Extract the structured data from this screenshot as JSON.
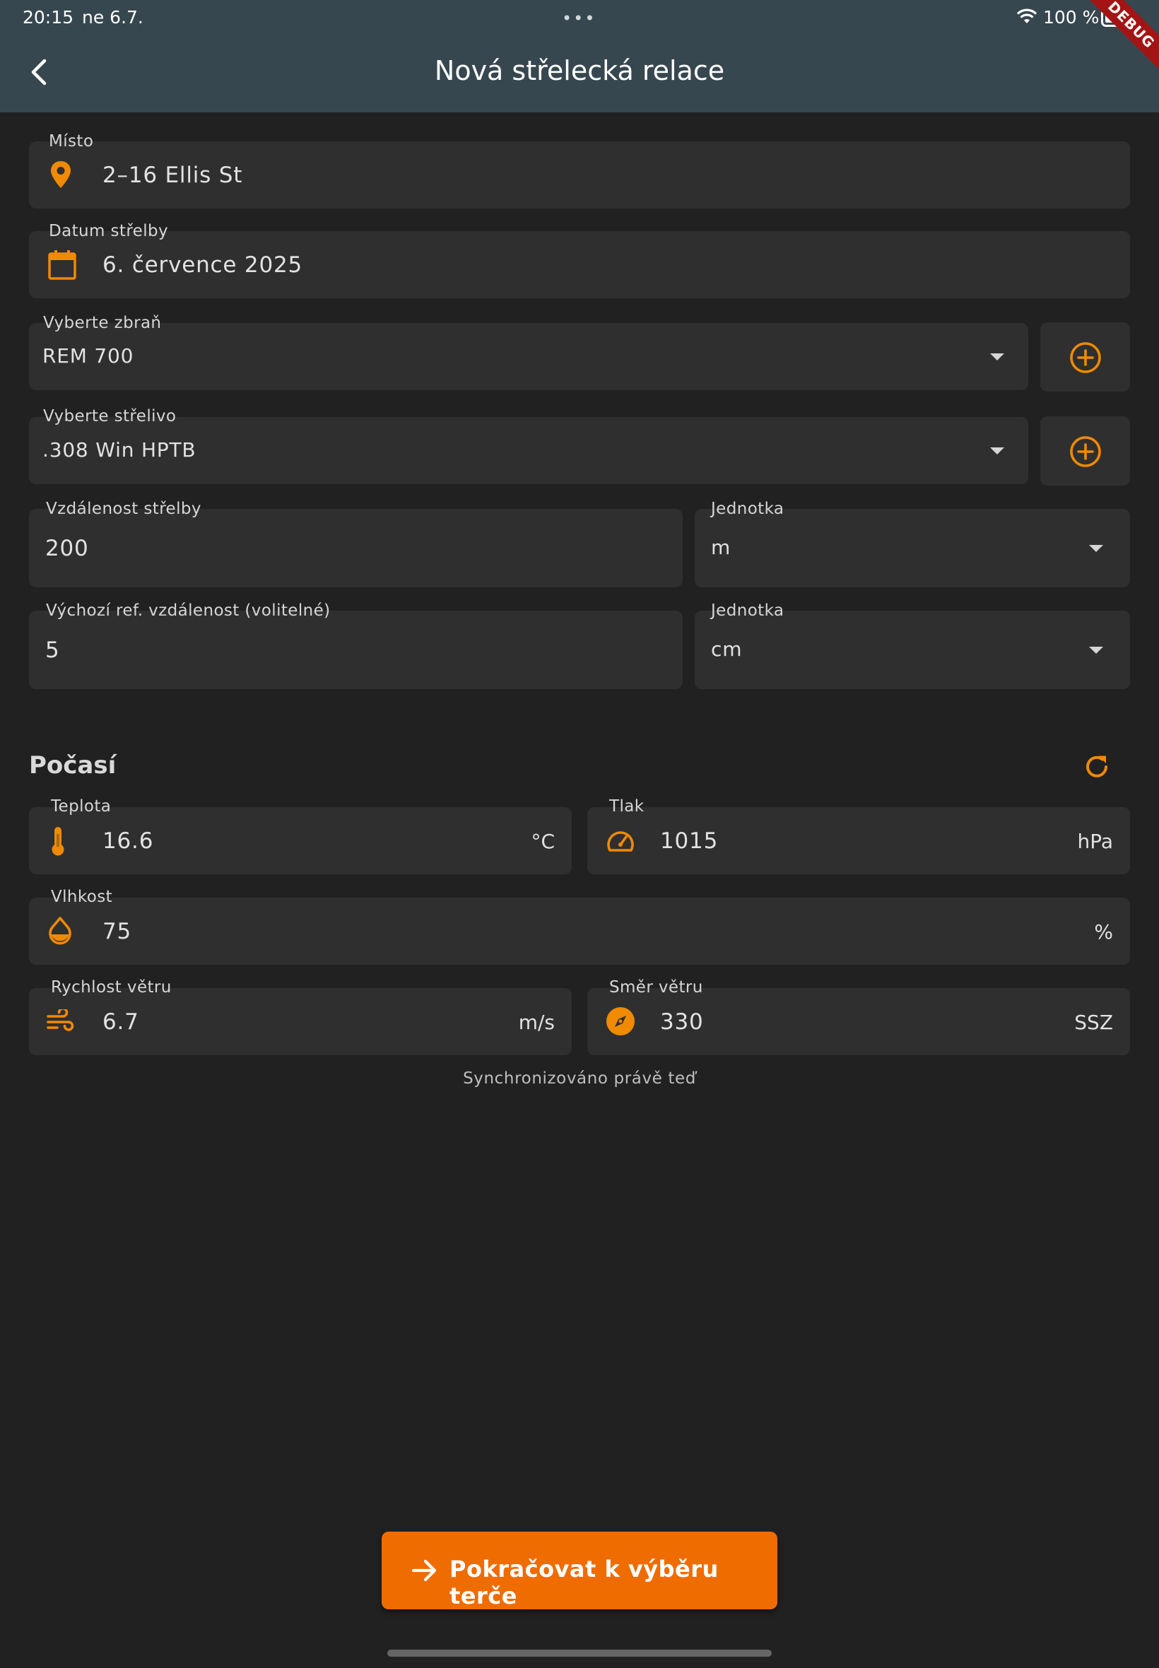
{
  "status_bar": {
    "time": "20:15",
    "date": "ne 6.7.",
    "dots": "•••",
    "battery": "100 %",
    "debug": "DEBUG"
  },
  "header": {
    "title": "Nová střelecká relace",
    "back_icon": "chevron-left-icon"
  },
  "form": {
    "location": {
      "label": "Místo",
      "value": "2–16 Ellis St",
      "icon": "location-pin-icon"
    },
    "date": {
      "label": "Datum střelby",
      "value": "6. července 2025",
      "icon": "calendar-icon"
    },
    "weapon": {
      "label": "Vyberte zbraň",
      "value": "REM 700",
      "add_icon": "add-circle-icon"
    },
    "ammo": {
      "label": "Vyberte střelivo",
      "value": ".308 Win HPTB",
      "add_icon": "add-circle-icon"
    },
    "distance": {
      "label": "Vzdálenost střelby",
      "value": "200",
      "unit_label": "Jednotka",
      "unit_value": "m"
    },
    "ref_distance": {
      "label": "Výchozí ref. vzdálenost (volitelné)",
      "value": "5",
      "unit_label": "Jednotka",
      "unit_value": "cm"
    }
  },
  "weather": {
    "title": "Počasí",
    "refresh_icon": "refresh-icon",
    "temperature": {
      "label": "Teplota",
      "value": "16.6",
      "suffix": "°C",
      "icon": "thermometer-icon"
    },
    "pressure": {
      "label": "Tlak",
      "value": "1015",
      "suffix": "hPa",
      "icon": "gauge-icon"
    },
    "humidity": {
      "label": "Vlhkost",
      "value": "75",
      "suffix": "%",
      "icon": "water-drop-icon"
    },
    "wind_speed": {
      "label": "Rychlost větru",
      "value": "6.7",
      "suffix": "m/s",
      "icon": "wind-icon"
    },
    "wind_direction": {
      "label": "Směr větru",
      "value": "330",
      "suffix": "SSZ",
      "icon": "compass-icon"
    },
    "sync_text": "Synchronizováno právě teď"
  },
  "cta": {
    "label": "Pokračovat k výběru terče",
    "icon": "arrow-right-icon"
  },
  "colors": {
    "accent": "#ef6c00",
    "icon_orange": "#f08a00",
    "appbar": "#37474f",
    "background": "#212121",
    "field": "#2f2f2f"
  }
}
